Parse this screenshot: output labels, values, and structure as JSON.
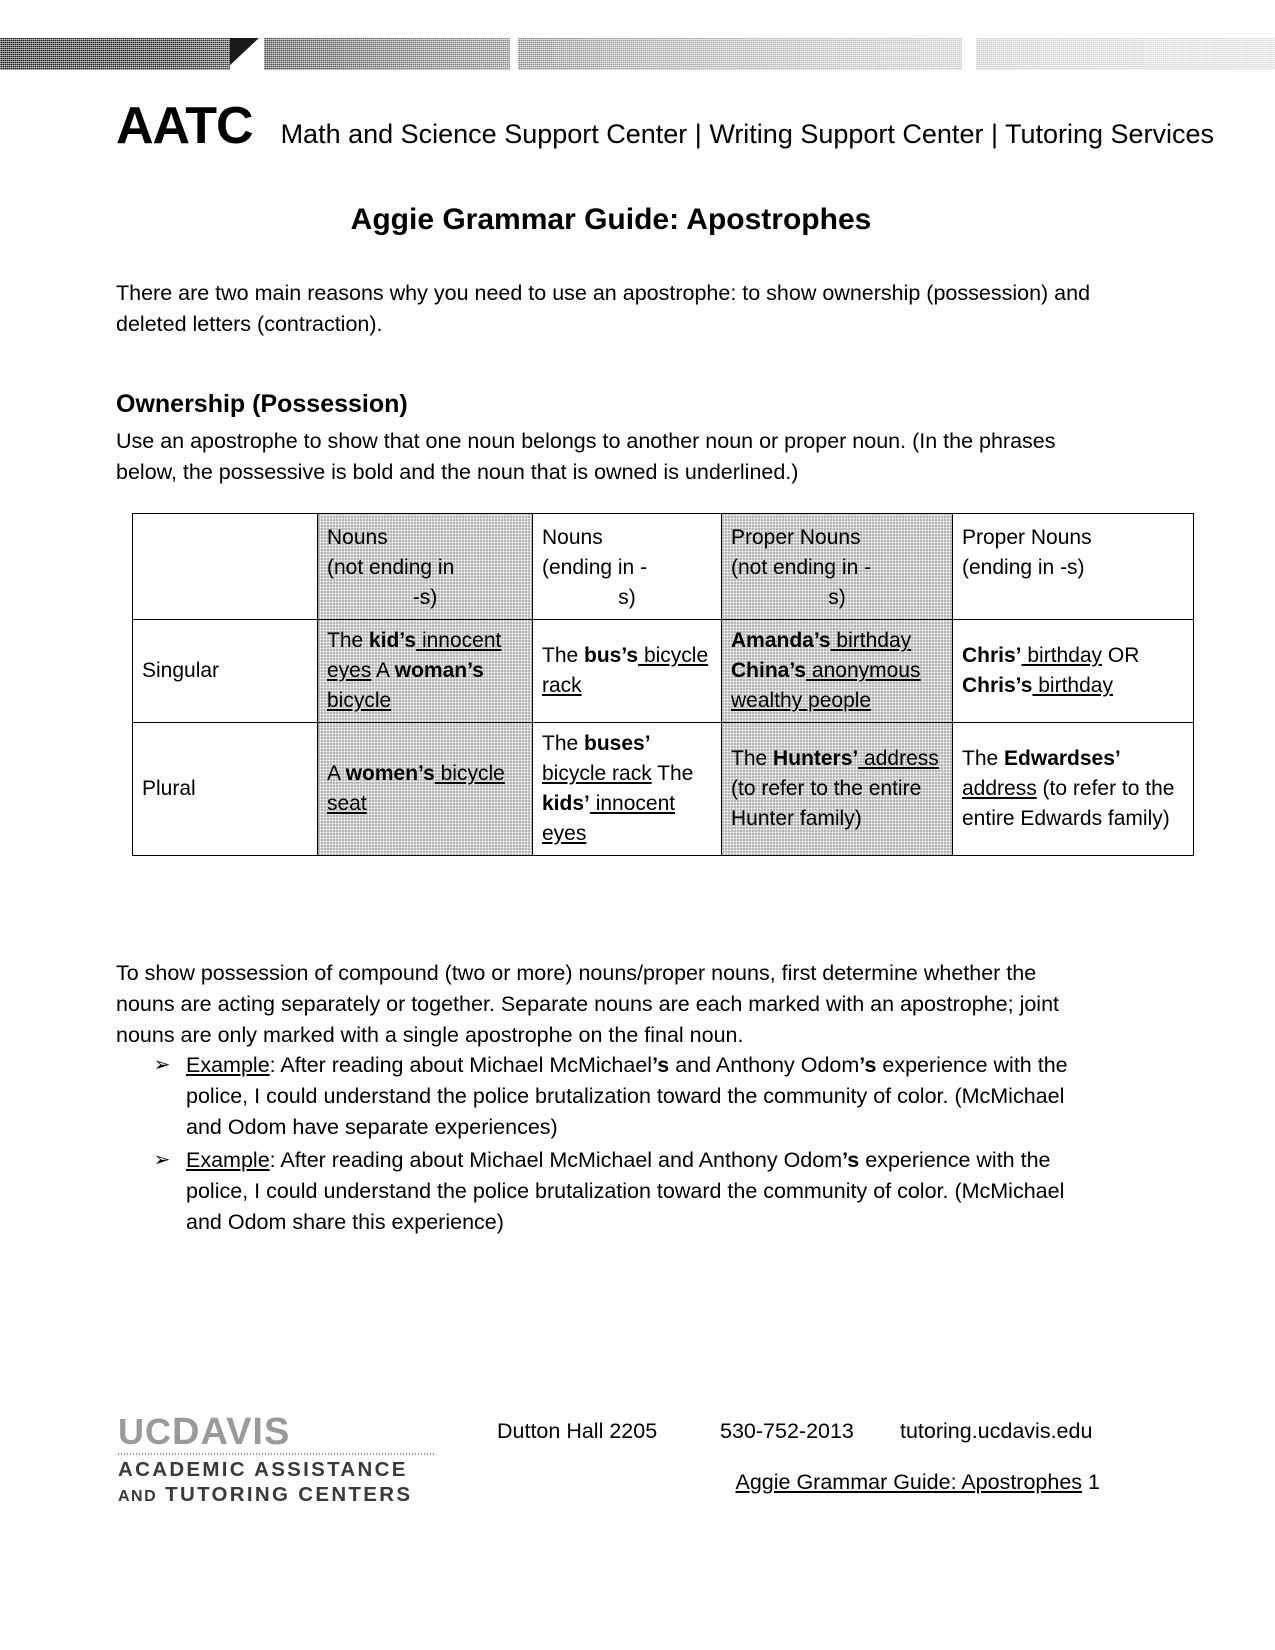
{
  "banner": {
    "gradient_from": "#1b1b1b",
    "gradient_to": "#dedede"
  },
  "masthead": {
    "logo_text": "AATC",
    "tagline": "Math and Science Support Center | Writing Support Center | Tutoring Services"
  },
  "title": "Aggie Grammar Guide: Apostrophes",
  "intro_paragraph": "There are two main reasons why you need to use an apostrophe: to show ownership (possession) and deleted letters (contraction).",
  "ownership": {
    "heading": "Ownership (Possession)",
    "paragraph": "Use an apostrophe to show that one noun belongs to another noun or proper noun. (In the phrases below, the possessive is bold and the noun that is owned is underlined.)"
  },
  "table": {
    "corner_label": "",
    "headers": [
      "Nouns (not ending in -s)",
      "Nouns (ending in  -s)",
      "Proper Nouns (not ending in -s)",
      "Proper Nouns (ending in -s)"
    ],
    "header_parts": [
      {
        "line1": "Nouns",
        "line2": "(not ending in",
        "line3": "-s)"
      },
      {
        "line1": "Nouns",
        "line2": "(ending in  -",
        "line3": "s)"
      },
      {
        "line1": "Proper Nouns",
        "line2": "(not ending in -",
        "line3": "s)"
      },
      {
        "line1": "Proper Nouns",
        "line2": "(ending in -s)",
        "line3": ""
      }
    ],
    "rows": [
      {
        "label": "Singular",
        "cells": {
          "nouns_not_s": [
            {
              "plain_before": "The ",
              "bold": "kid’s",
              "underline": " innocent eyes"
            },
            {
              "plain_before": "A ",
              "bold": "woman’s",
              "underline": " bicycle"
            }
          ],
          "nouns_s": [
            {
              "plain_before": "The ",
              "bold": "bus’s",
              "underline": " bicycle rack"
            }
          ],
          "proper_not_s": [
            {
              "plain_before": "",
              "bold": "Amanda’s",
              "underline": " birthday"
            },
            {
              "plain_before": "",
              "bold": "China’s",
              "underline": " anonymous wealthy people"
            }
          ],
          "proper_s": [
            {
              "plain_before": "",
              "bold": "Chris’",
              "underline": " birthday",
              "plain_after": " OR"
            },
            {
              "plain_before": "",
              "bold": "Chris’s",
              "underline": " birthday"
            }
          ]
        }
      },
      {
        "label": "Plural",
        "cells": {
          "nouns_not_s": [
            {
              "plain_before": "A ",
              "bold": "women’s",
              "underline": " bicycle seat"
            }
          ],
          "nouns_s": [
            {
              "plain_before": "The ",
              "bold": "buses’",
              "underline": " bicycle rack"
            },
            {
              "plain_before": "The ",
              "bold": "kids’",
              "underline": " innocent eyes"
            }
          ],
          "proper_not_s": [
            {
              "plain_before": "The ",
              "bold": "Hunters’",
              "underline": " address",
              "plain_after": " (to refer to the entire Hunter family)"
            }
          ],
          "proper_s": [
            {
              "plain_before": "The ",
              "bold": "Edwardses’",
              "underline": " address",
              "plain_after": " (to refer to the entire Edwards family)"
            }
          ]
        }
      }
    ]
  },
  "compound_paragraph": "To show possession of compound (two or more) nouns/proper nouns, first determine whether the nouns are acting separately or together. Separate nouns are each marked with an apostrophe; joint nouns are only marked with a single apostrophe on the final noun.",
  "bullets": [
    {
      "marker": "➢",
      "label": "Example",
      "text_1": ": After reading about Michael McMichael",
      "bold_1": "’s",
      "text_2": " and Anthony Odom",
      "bold_2": "’s",
      "text_3": " experience with the police, I could understand the police brutalization toward the community of color. (McMichael and Odom have separate experiences)"
    },
    {
      "marker": "➢",
      "label": "Example",
      "text_1": ": After reading about Michael McMichael and Anthony Odom",
      "bold_1": "’s",
      "text_2": "",
      "bold_2": "",
      "text_3": " experience with the police, I could understand the police brutalization toward the community of color. (McMichael and Odom share this experience)"
    }
  ],
  "footer": {
    "logo_uc": "UC",
    "logo_davis": "DAVIS",
    "logo_line2": "ACADEMIC ASSISTANCE",
    "logo_line3_small": "AND",
    "logo_line3": "TUTORING CENTERS",
    "room": "Dutton Hall 2205",
    "phone": "530-752-2013",
    "website": "tutoring.ucdavis.edu",
    "doc_link": "Aggie Grammar Guide: Apostrophes",
    "page_number": "1"
  }
}
